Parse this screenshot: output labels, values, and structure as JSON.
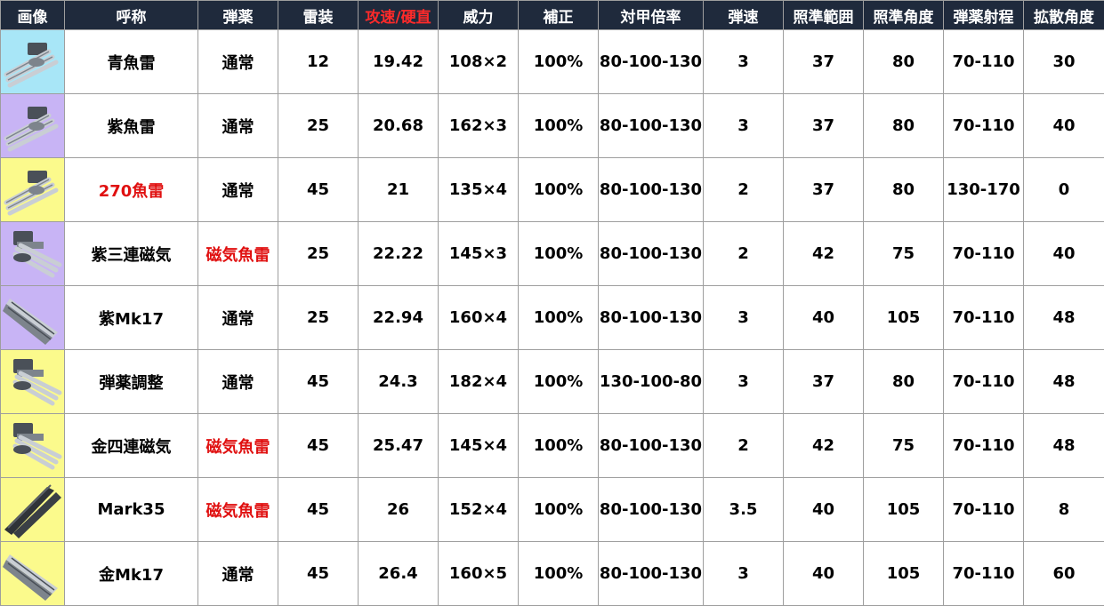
{
  "headers": [
    "画像",
    "呼称",
    "弾薬",
    "雷装",
    "攻速/硬直",
    "威力",
    "補正",
    "対甲倍率",
    "弾速",
    "照準範囲",
    "照準角度",
    "弾薬射程",
    "拡散角度"
  ],
  "header_highlight_color": "#ff2a2a",
  "rows": [
    {
      "icon": "torpedo-launcher-blue-icon",
      "bg": "#a8e6f7",
      "name": "青魚雷",
      "name_red": false,
      "ammo": "通常",
      "ammo_red": false,
      "torpedo": "12",
      "speed": "19.42",
      "power": "108×2",
      "mod": "100%",
      "armor": "80-100-130",
      "velocity": "3",
      "aim_range": "37",
      "aim_angle": "80",
      "ammo_range": "70-110",
      "spread": "30"
    },
    {
      "icon": "torpedo-launcher-purple-icon",
      "bg": "#c8b4f5",
      "name": "紫魚雷",
      "name_red": false,
      "ammo": "通常",
      "ammo_red": false,
      "torpedo": "25",
      "speed": "20.68",
      "power": "162×3",
      "mod": "100%",
      "armor": "80-100-130",
      "velocity": "3",
      "aim_range": "37",
      "aim_angle": "80",
      "ammo_range": "70-110",
      "spread": "40"
    },
    {
      "icon": "torpedo-launcher-gold-icon",
      "bg": "#fbfa8c",
      "name": "270魚雷",
      "name_red": true,
      "ammo": "通常",
      "ammo_red": false,
      "torpedo": "45",
      "speed": "21",
      "power": "135×4",
      "mod": "100%",
      "armor": "80-100-130",
      "velocity": "2",
      "aim_range": "37",
      "aim_angle": "80",
      "ammo_range": "130-170",
      "spread": "0"
    },
    {
      "icon": "triple-magnetic-launcher-purple-icon",
      "bg": "#c8b4f5",
      "name": "紫三連磁気",
      "name_red": false,
      "ammo": "磁気魚雷",
      "ammo_red": true,
      "torpedo": "25",
      "speed": "22.22",
      "power": "145×3",
      "mod": "100%",
      "armor": "80-100-130",
      "velocity": "2",
      "aim_range": "42",
      "aim_angle": "75",
      "ammo_range": "70-110",
      "spread": "40"
    },
    {
      "icon": "mk17-launcher-purple-icon",
      "bg": "#c8b4f5",
      "name": "紫Mk17",
      "name_red": false,
      "ammo": "通常",
      "ammo_red": false,
      "torpedo": "25",
      "speed": "22.94",
      "power": "160×4",
      "mod": "100%",
      "armor": "80-100-130",
      "velocity": "3",
      "aim_range": "40",
      "aim_angle": "105",
      "ammo_range": "70-110",
      "spread": "48"
    },
    {
      "icon": "ammo-adjust-launcher-gold-icon",
      "bg": "#fbfa8c",
      "name": "弾薬調整",
      "name_red": false,
      "ammo": "通常",
      "ammo_red": false,
      "torpedo": "45",
      "speed": "24.3",
      "power": "182×4",
      "mod": "100%",
      "armor": "130-100-80",
      "velocity": "3",
      "aim_range": "37",
      "aim_angle": "80",
      "ammo_range": "70-110",
      "spread": "48"
    },
    {
      "icon": "quad-magnetic-launcher-gold-icon",
      "bg": "#fbfa8c",
      "name": "金四連磁気",
      "name_red": false,
      "ammo": "磁気魚雷",
      "ammo_red": true,
      "torpedo": "45",
      "speed": "25.47",
      "power": "145×4",
      "mod": "100%",
      "armor": "80-100-130",
      "velocity": "2",
      "aim_range": "42",
      "aim_angle": "75",
      "ammo_range": "70-110",
      "spread": "48"
    },
    {
      "icon": "mark35-launcher-gold-icon",
      "bg": "#fbfa8c",
      "name": "Mark35",
      "name_red": false,
      "ammo": "磁気魚雷",
      "ammo_red": true,
      "torpedo": "45",
      "speed": "26",
      "power": "152×4",
      "mod": "100%",
      "armor": "80-100-130",
      "velocity": "3.5",
      "aim_range": "40",
      "aim_angle": "105",
      "ammo_range": "70-110",
      "spread": "8"
    },
    {
      "icon": "mk17-launcher-gold-icon",
      "bg": "#fbfa8c",
      "name": "金Mk17",
      "name_red": false,
      "ammo": "通常",
      "ammo_red": false,
      "torpedo": "45",
      "speed": "26.4",
      "power": "160×5",
      "mod": "100%",
      "armor": "80-100-130",
      "velocity": "3",
      "aim_range": "40",
      "aim_angle": "105",
      "ammo_range": "70-110",
      "spread": "60"
    }
  ]
}
